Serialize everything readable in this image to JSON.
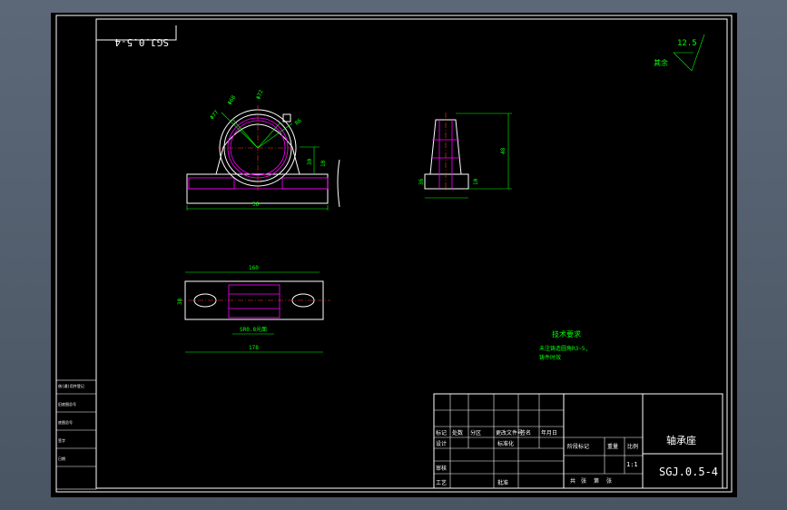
{
  "drawing_number": "SGJ.0.5-4",
  "drawing_number_mirrored": "SGJ.0.5-4",
  "part_name": "轴承座",
  "scale": "1:1",
  "roughness": {
    "value": "12.5",
    "label": "其余"
  },
  "tech_requirements": {
    "title": "技术要求",
    "line1": "未注铸造圆角R3~5,",
    "line2": "铸件时效"
  },
  "front_view_dims": {
    "d1": "Φ77",
    "d2": "Φ68",
    "d3": "Φ72",
    "d4": "R6",
    "d5": "30",
    "d6": "10",
    "width": "36"
  },
  "side_view_dims": {
    "height": "48",
    "base": "36",
    "foot": "10"
  },
  "top_view_dims": {
    "inner": "160",
    "outer": "178",
    "depth": "38",
    "note": "SR0.8光面"
  },
  "title_block": {
    "r1": [
      "标记",
      "处数",
      "分区",
      "更改文件号",
      "签名",
      "年月日"
    ],
    "r2": [
      "设计",
      "",
      "",
      "标准化"
    ],
    "r3": [
      "审核"
    ],
    "r4": [
      "工艺",
      "",
      "",
      "批准"
    ],
    "mid": [
      "阶段标记",
      "重量",
      "比例"
    ],
    "bottom": [
      "共",
      "张",
      "第",
      "张"
    ]
  },
  "side_strip": {
    "s1": "借(通)用件登记",
    "s2": "旧底图总号",
    "s3": "底图总号",
    "s4": "签字",
    "s5": "日期"
  }
}
